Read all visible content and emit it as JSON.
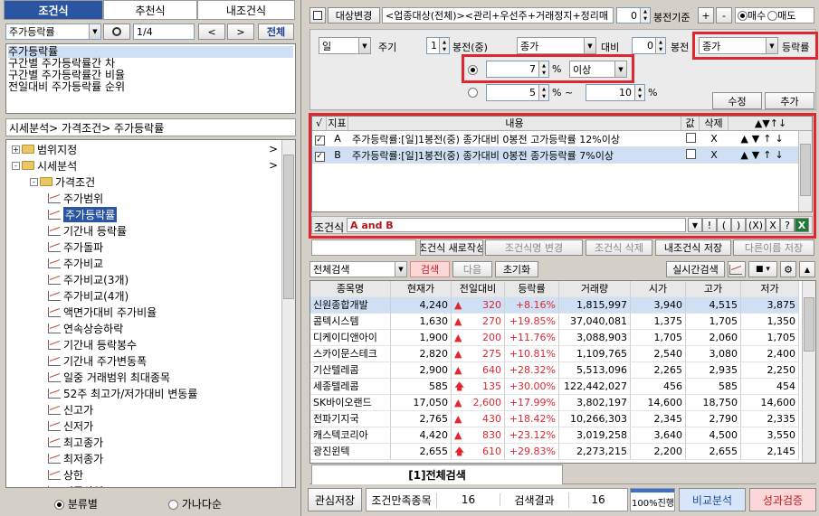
{
  "left": {
    "tabs": [
      "조건식",
      "추천식",
      "내조건식"
    ],
    "search_value": "주가등락률",
    "page_indicator": "1/4",
    "prev_label": "<",
    "next_label": ">",
    "all_label": "전체",
    "results": [
      "주가등락률",
      "구간별 주가등락률간 차",
      "구간별 주가등락률간 비율",
      "전일대비 주가등락률 순위"
    ],
    "breadcrumb": "시세분석> 가격조건> 주가등락률",
    "tree": [
      {
        "label": "범위지정",
        "level": 0,
        "type": "folder",
        "expand": "+",
        "arrow": ">"
      },
      {
        "label": "시세분석",
        "level": 0,
        "type": "folder",
        "expand": "-",
        "arrow": ">"
      },
      {
        "label": "가격조건",
        "level": 1,
        "type": "folder",
        "expand": "-"
      },
      {
        "label": "주가범위",
        "level": 2,
        "type": "item"
      },
      {
        "label": "주가등락률",
        "level": 2,
        "type": "item",
        "selected": true
      },
      {
        "label": "기간내 등락률",
        "level": 2,
        "type": "item"
      },
      {
        "label": "주가돌파",
        "level": 2,
        "type": "item"
      },
      {
        "label": "주가비교",
        "level": 2,
        "type": "item"
      },
      {
        "label": "주가비교(3개)",
        "level": 2,
        "type": "item"
      },
      {
        "label": "주가비교(4개)",
        "level": 2,
        "type": "item"
      },
      {
        "label": "액면가대비 주가비율",
        "level": 2,
        "type": "item"
      },
      {
        "label": "연속상승하락",
        "level": 2,
        "type": "item"
      },
      {
        "label": "기간내 등락봉수",
        "level": 2,
        "type": "item"
      },
      {
        "label": "기간내 주가변동폭",
        "level": 2,
        "type": "item"
      },
      {
        "label": "일중 거래범위 최대종목",
        "level": 2,
        "type": "item"
      },
      {
        "label": "52주 최고가/저가대비 변동률",
        "level": 2,
        "type": "item"
      },
      {
        "label": "신고가",
        "level": 2,
        "type": "item"
      },
      {
        "label": "신저가",
        "level": 2,
        "type": "item"
      },
      {
        "label": "최고종가",
        "level": 2,
        "type": "item"
      },
      {
        "label": "최저종가",
        "level": 2,
        "type": "item"
      },
      {
        "label": "상한",
        "level": 2,
        "type": "item"
      },
      {
        "label": "전종산익",
        "level": 2,
        "type": "item"
      }
    ],
    "bottom_radio_1": "분류별",
    "bottom_radio_2": "가나다순"
  },
  "top": {
    "target_label": "대상변경",
    "target_value": "<업종대상(전체)><관리+우선주+거래정지+정리매",
    "bong_value": "0",
    "bong_label": "봉전기준",
    "plus": "+",
    "minus": "-",
    "buy": "매수",
    "sell": "매도"
  },
  "cond": {
    "period_value": "일",
    "period_label": "주기",
    "bong1_value": "1",
    "bong1_label": "봉전(중)",
    "price_value": "종가",
    "compare_label": "대비",
    "bong2_value": "0",
    "bong2_label": "봉전",
    "price2_value": "종가",
    "rate_label": "등락률",
    "pct_value": "7",
    "pct_unit": "%",
    "over_value": "이상",
    "range_from": "5",
    "range_unit": "% ~",
    "range_to": "10",
    "range_unit2": "%",
    "modify": "수정",
    "add": "추가"
  },
  "formula": {
    "headers": [
      "√",
      "지표",
      "내용",
      "값",
      "삭제",
      "▲▼↑↓"
    ],
    "rows": [
      {
        "key": "A",
        "content": "주가등락률:[일]1봉전(중) 종가대비 0봉전 고가등락률 12%이상",
        "del": "X",
        "moves": "▲▼↑↓"
      },
      {
        "key": "B",
        "content": "주가등락률:[일]1봉전(중) 종가대비 0봉전 종가등락률 7%이상",
        "del": "X",
        "moves": "▲▼↑↓"
      }
    ],
    "expr_label": "조건식",
    "expr_value": "A and B",
    "tool_buttons": [
      "!",
      "(",
      ")",
      "(X)",
      "X",
      "?"
    ]
  },
  "actions": [
    "조건식 새로작성",
    "조건식명 변경",
    "조건식 삭제",
    "내조건식 저장",
    "다른이름 저장"
  ],
  "search": {
    "scope_value": "전체검색",
    "search_label": "검색",
    "next_label": "다음",
    "reset_label": "초기화",
    "realtime_label": "실시간검색"
  },
  "grid": {
    "headers": [
      "종목명",
      "현재가",
      "전일대비",
      "등락률",
      "거래량",
      "시가",
      "고가",
      "저가"
    ],
    "rows": [
      [
        "신원종합개발",
        "4,240",
        "320",
        "+8.16%",
        "1,815,997",
        "3,940",
        "4,515",
        "3,875"
      ],
      [
        "콤텍시스템",
        "1,630",
        "270",
        "+19.85%",
        "37,040,081",
        "1,375",
        "1,705",
        "1,350"
      ],
      [
        "디케이디앤아이",
        "1,900",
        "200",
        "+11.76%",
        "3,088,903",
        "1,705",
        "2,060",
        "1,705"
      ],
      [
        "스카이문스테크",
        "2,820",
        "275",
        "+10.81%",
        "1,109,765",
        "2,540",
        "3,080",
        "2,400"
      ],
      [
        "기산텔레콤",
        "2,900",
        "640",
        "+28.32%",
        "5,513,096",
        "2,265",
        "2,935",
        "2,250"
      ],
      [
        "세종텔레콤",
        "585",
        "135",
        "+30.00%",
        "122,442,027",
        "456",
        "585",
        "454"
      ],
      [
        "SK바이오랜드",
        "17,050",
        "2,600",
        "+17.99%",
        "3,802,197",
        "14,600",
        "18,750",
        "14,600"
      ],
      [
        "전파기지국",
        "2,765",
        "430",
        "+18.42%",
        "10,266,303",
        "2,345",
        "2,790",
        "2,335"
      ],
      [
        "캐스텍코리아",
        "4,420",
        "830",
        "+23.12%",
        "3,019,258",
        "3,640",
        "4,500",
        "3,550"
      ],
      [
        "광진윈텍",
        "2,655",
        "610",
        "+29.83%",
        "2,273,215",
        "2,200",
        "2,655",
        "2,145"
      ]
    ],
    "limit_up_rows": [
      5,
      9
    ],
    "tab_label": "[1]전체검색"
  },
  "status": {
    "save_label": "관심저장",
    "match_label": "조건만족종목",
    "match_count": "16",
    "result_label": "검색결과",
    "result_count": "16",
    "progress_text": "100%진행",
    "progress": 1.0,
    "compare_label": "비교분석",
    "verify_label": "성과검증"
  },
  "colors": {
    "accent": "#e0262e",
    "tab_active": "#2a55a3",
    "selected": "#cfe0f5"
  }
}
